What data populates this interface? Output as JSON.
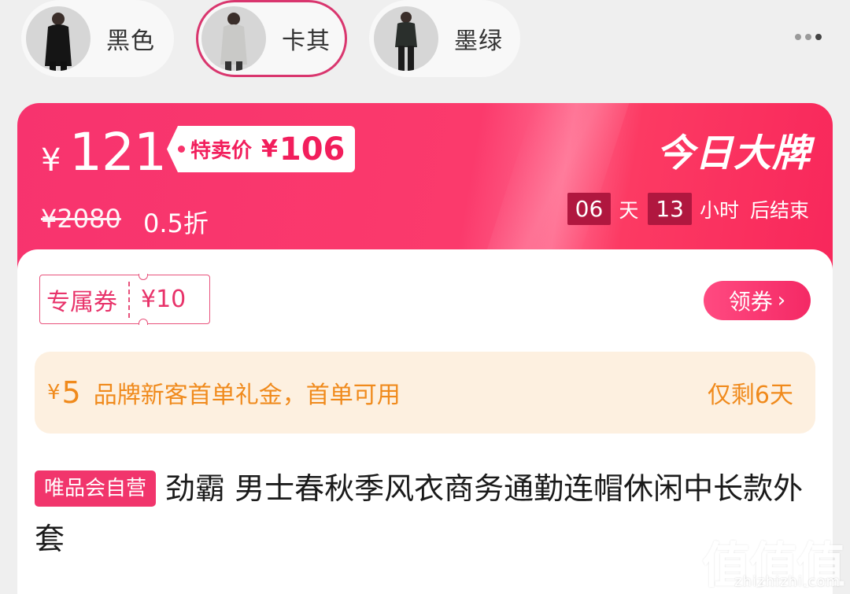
{
  "colors": {
    "accent": "#f8336b",
    "gift_text": "#f08a1c",
    "gift_bg": "#fdf0e0",
    "countdown_box": "#b0173f"
  },
  "variants": [
    {
      "label": "黑色",
      "selected": false,
      "image": "black-coat-model"
    },
    {
      "label": "卡其",
      "selected": true,
      "image": "khaki-coat-model"
    },
    {
      "label": "墨绿",
      "selected": false,
      "image": "dark-green-coat-model"
    }
  ],
  "price": {
    "currency": "¥",
    "current": "121",
    "special_label": "特卖价",
    "special_currency": "¥",
    "special_price": "106",
    "original": "¥2080",
    "discount": "0.5折",
    "brand_event": "今日大牌"
  },
  "countdown": {
    "days": "06",
    "days_unit": "天",
    "hours": "13",
    "hours_unit": "小时",
    "suffix": "后结束"
  },
  "coupon": {
    "name": "专属券",
    "amount": "¥10",
    "action": "领券"
  },
  "gift": {
    "currency": "¥",
    "amount": "5",
    "text": "品牌新客首单礼金，首单可用",
    "remaining": "仅剩6天"
  },
  "product": {
    "badge": "唯品会自营",
    "title": "劲霸 男士春秋季风衣商务通勤连帽休闲中长款外套"
  },
  "watermark": {
    "logo": "值值值",
    "url": "zhizhizhi.com"
  }
}
